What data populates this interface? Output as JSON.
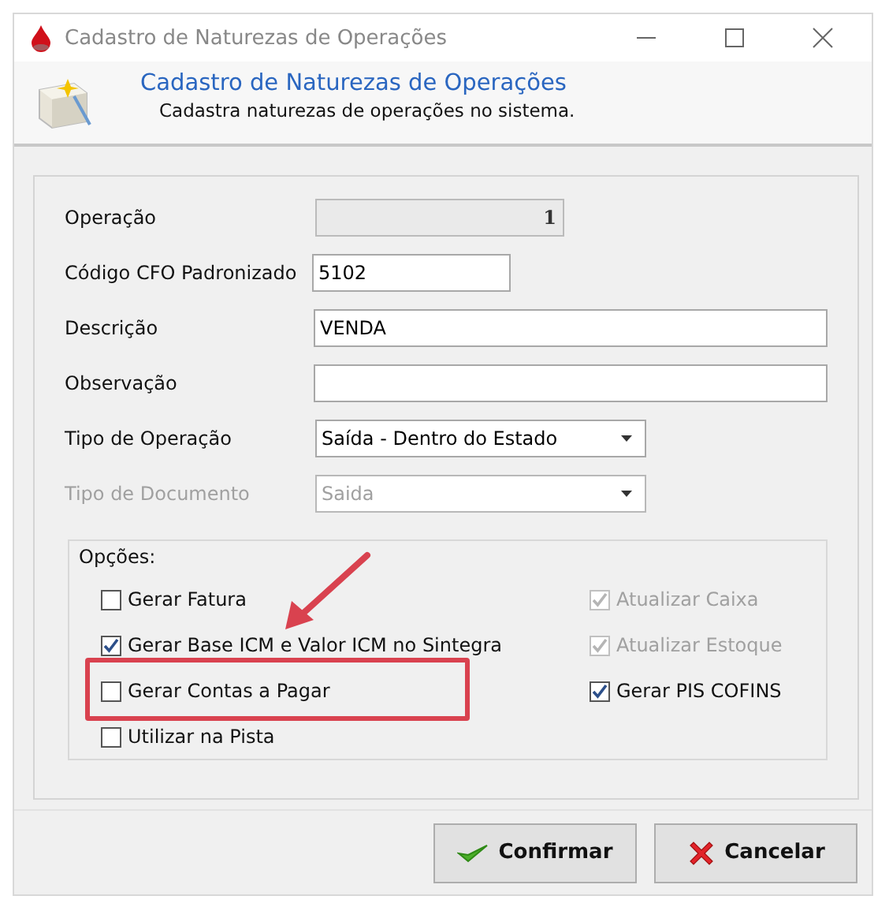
{
  "window": {
    "title": "Cadastro de Naturezas de Operações"
  },
  "header": {
    "title": "Cadastro de Naturezas de Operações",
    "subtitle": "Cadastra naturezas de operações no sistema."
  },
  "fields": [
    {
      "label": "Operação",
      "kind": "number",
      "value": "1",
      "disabled": true
    },
    {
      "label": "Código CFO Padronizado",
      "kind": "text",
      "value": "5102",
      "disabled": false
    },
    {
      "label": "Descrição",
      "kind": "text",
      "value": "VENDA",
      "disabled": false
    },
    {
      "label": "Observação",
      "kind": "text",
      "disabled": false
    },
    {
      "label": "Tipo de Operação",
      "kind": "select",
      "value": "Saída - Dentro do Estado",
      "disabled": false
    },
    {
      "label": "Tipo de Documento",
      "kind": "select",
      "value": "Saida",
      "disabled": true,
      "label_disabled": true
    }
  ],
  "options": {
    "title": "Opções:",
    "columns": [
      [
        {
          "label": "Gerar Fatura",
          "checked": false,
          "disabled": false
        },
        {
          "label": "Gerar Base ICM e Valor ICM no Sintegra",
          "checked": true,
          "disabled": false
        },
        {
          "label": "Gerar Contas a Pagar",
          "checked": false,
          "disabled": false
        },
        {
          "label": "Utilizar na Pista",
          "checked": false,
          "disabled": false
        }
      ],
      [
        {
          "label": "Atualizar Caixa",
          "checked": true,
          "disabled": true
        },
        {
          "label": "Atualizar Estoque",
          "checked": true,
          "disabled": true
        },
        {
          "label": "Gerar PIS COFINS",
          "checked": true,
          "disabled": false
        }
      ]
    ]
  },
  "buttons": [
    {
      "label": "Confirmar",
      "kind": "confirm"
    },
    {
      "label": "Cancelar",
      "kind": "cancel"
    }
  ]
}
